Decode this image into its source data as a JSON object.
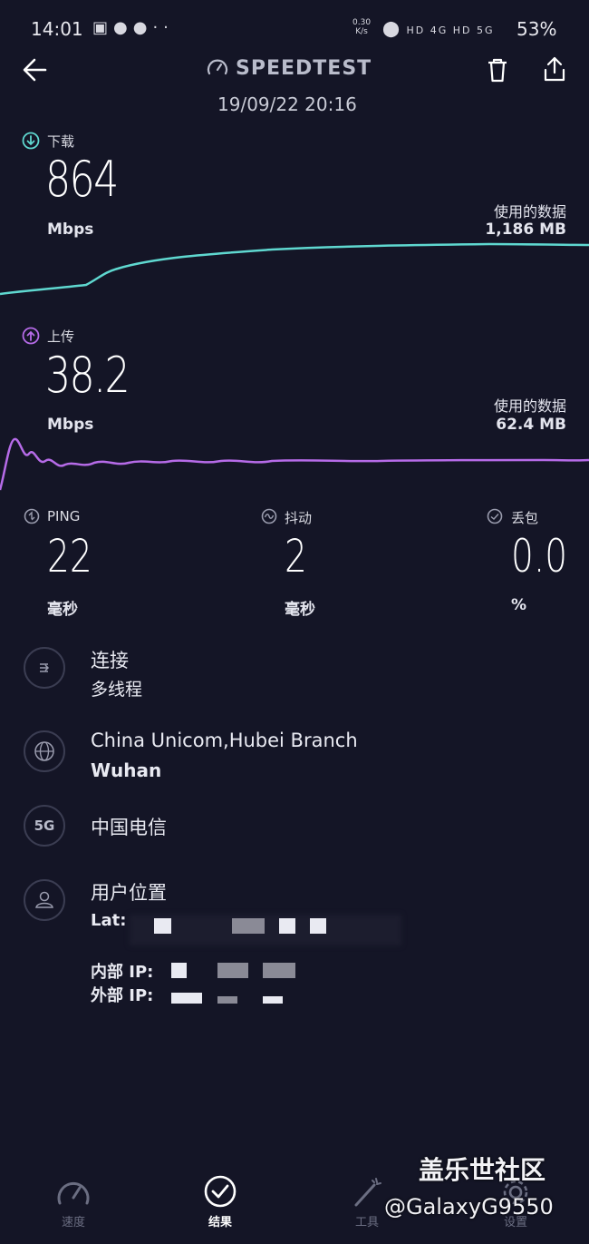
{
  "status_bar": {
    "time": "14:01",
    "net_speed": "0.30",
    "net_unit": "K/s",
    "network_labels": "HD 4G HD 5G",
    "battery": "53%"
  },
  "header": {
    "title": "SPEEDTEST",
    "date": "19/09/22 20:16"
  },
  "download": {
    "label": "下载",
    "value": "864",
    "unit": "Mbps",
    "data_used_label": "使用的数据",
    "data_used": "1,186 MB",
    "color": "#5fd8d0"
  },
  "upload": {
    "label": "上传",
    "value": "38.2",
    "unit": "Mbps",
    "data_used_label": "使用的数据",
    "data_used": "62.4 MB",
    "color": "#b66be8"
  },
  "metrics": {
    "ping": {
      "label": "PING",
      "value": "22",
      "unit": "毫秒"
    },
    "jitter": {
      "label": "抖动",
      "value": "2",
      "unit": "毫秒"
    },
    "loss": {
      "label": "丢包",
      "value": "0.0",
      "unit": "%"
    }
  },
  "info": {
    "connection": {
      "title": "连接",
      "value": "多线程"
    },
    "server": {
      "title": "China Unicom,Hubei Branch",
      "value": "Wuhan"
    },
    "carrier": {
      "icon_text": "5G",
      "title": "中国电信"
    },
    "location": {
      "title": "用户位置",
      "lat_label": "Lat:",
      "internal_ip_label": "内部 IP:",
      "external_ip_label": "外部 IP:"
    }
  },
  "bottom_nav": {
    "items": [
      {
        "label": "速度",
        "icon": "gauge-icon",
        "active": false
      },
      {
        "label": "结果",
        "icon": "check-circle-icon",
        "active": true
      },
      {
        "label": "工具",
        "icon": "wand-icon",
        "active": false
      },
      {
        "label": "设置",
        "icon": "gear-icon",
        "active": false
      }
    ]
  },
  "watermark": {
    "line1": "盖乐世社区",
    "line2": "@GalaxyG9550"
  }
}
